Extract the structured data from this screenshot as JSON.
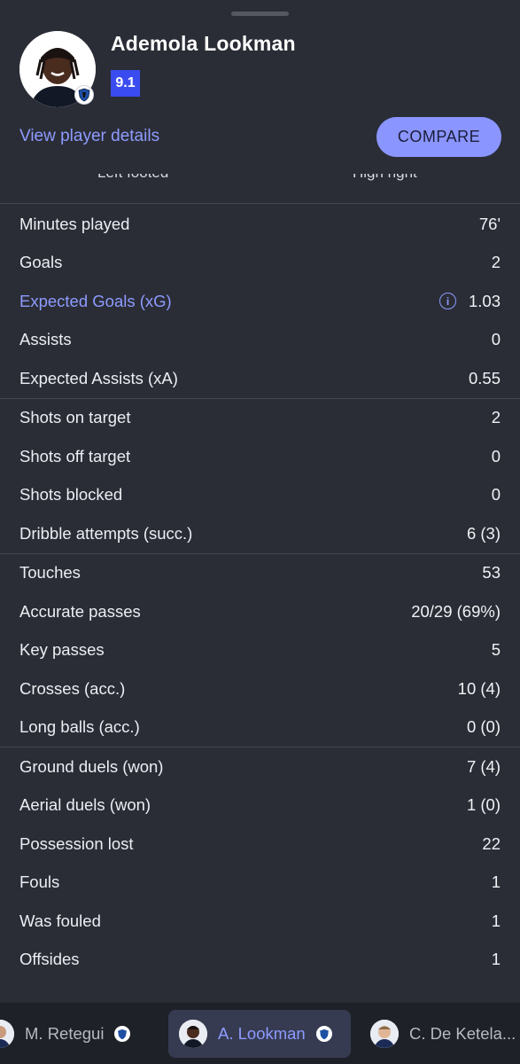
{
  "header": {
    "player_name": "Ademola Lookman",
    "rating": "9.1",
    "details_link": "View player details",
    "compare_label": "COMPARE",
    "peek_left": "Left footed",
    "peek_right": "High right"
  },
  "colors": {
    "background": "#2a2d36",
    "accent": "#8e9bff",
    "rating_badge": "#3a4cf0",
    "compare_button": "#8a95ff"
  },
  "stat_groups": [
    [
      {
        "label": "Minutes played",
        "value": "76'"
      },
      {
        "label": "Goals",
        "value": "2"
      },
      {
        "label": "Expected Goals (xG)",
        "value": "1.03",
        "info": true
      },
      {
        "label": "Assists",
        "value": "0"
      },
      {
        "label": "Expected Assists (xA)",
        "value": "0.55"
      }
    ],
    [
      {
        "label": "Shots on target",
        "value": "2"
      },
      {
        "label": "Shots off target",
        "value": "0"
      },
      {
        "label": "Shots blocked",
        "value": "0"
      },
      {
        "label": "Dribble attempts (succ.)",
        "value": "6 (3)"
      }
    ],
    [
      {
        "label": "Touches",
        "value": "53"
      },
      {
        "label": "Accurate passes",
        "value": "20/29 (69%)"
      },
      {
        "label": "Key passes",
        "value": "5"
      },
      {
        "label": "Crosses (acc.)",
        "value": "10 (4)"
      },
      {
        "label": "Long balls (acc.)",
        "value": "0 (0)"
      }
    ],
    [
      {
        "label": "Ground duels (won)",
        "value": "7 (4)"
      },
      {
        "label": "Aerial duels (won)",
        "value": "1 (0)"
      },
      {
        "label": "Possession lost",
        "value": "22"
      },
      {
        "label": "Fouls",
        "value": "1"
      },
      {
        "label": "Was fouled",
        "value": "1"
      },
      {
        "label": "Offsides",
        "value": "1"
      }
    ]
  ],
  "bottom_players": [
    {
      "name": "M. Retegui"
    },
    {
      "name": "A. Lookman",
      "active": true
    },
    {
      "name": "C. De Ketela..."
    }
  ]
}
